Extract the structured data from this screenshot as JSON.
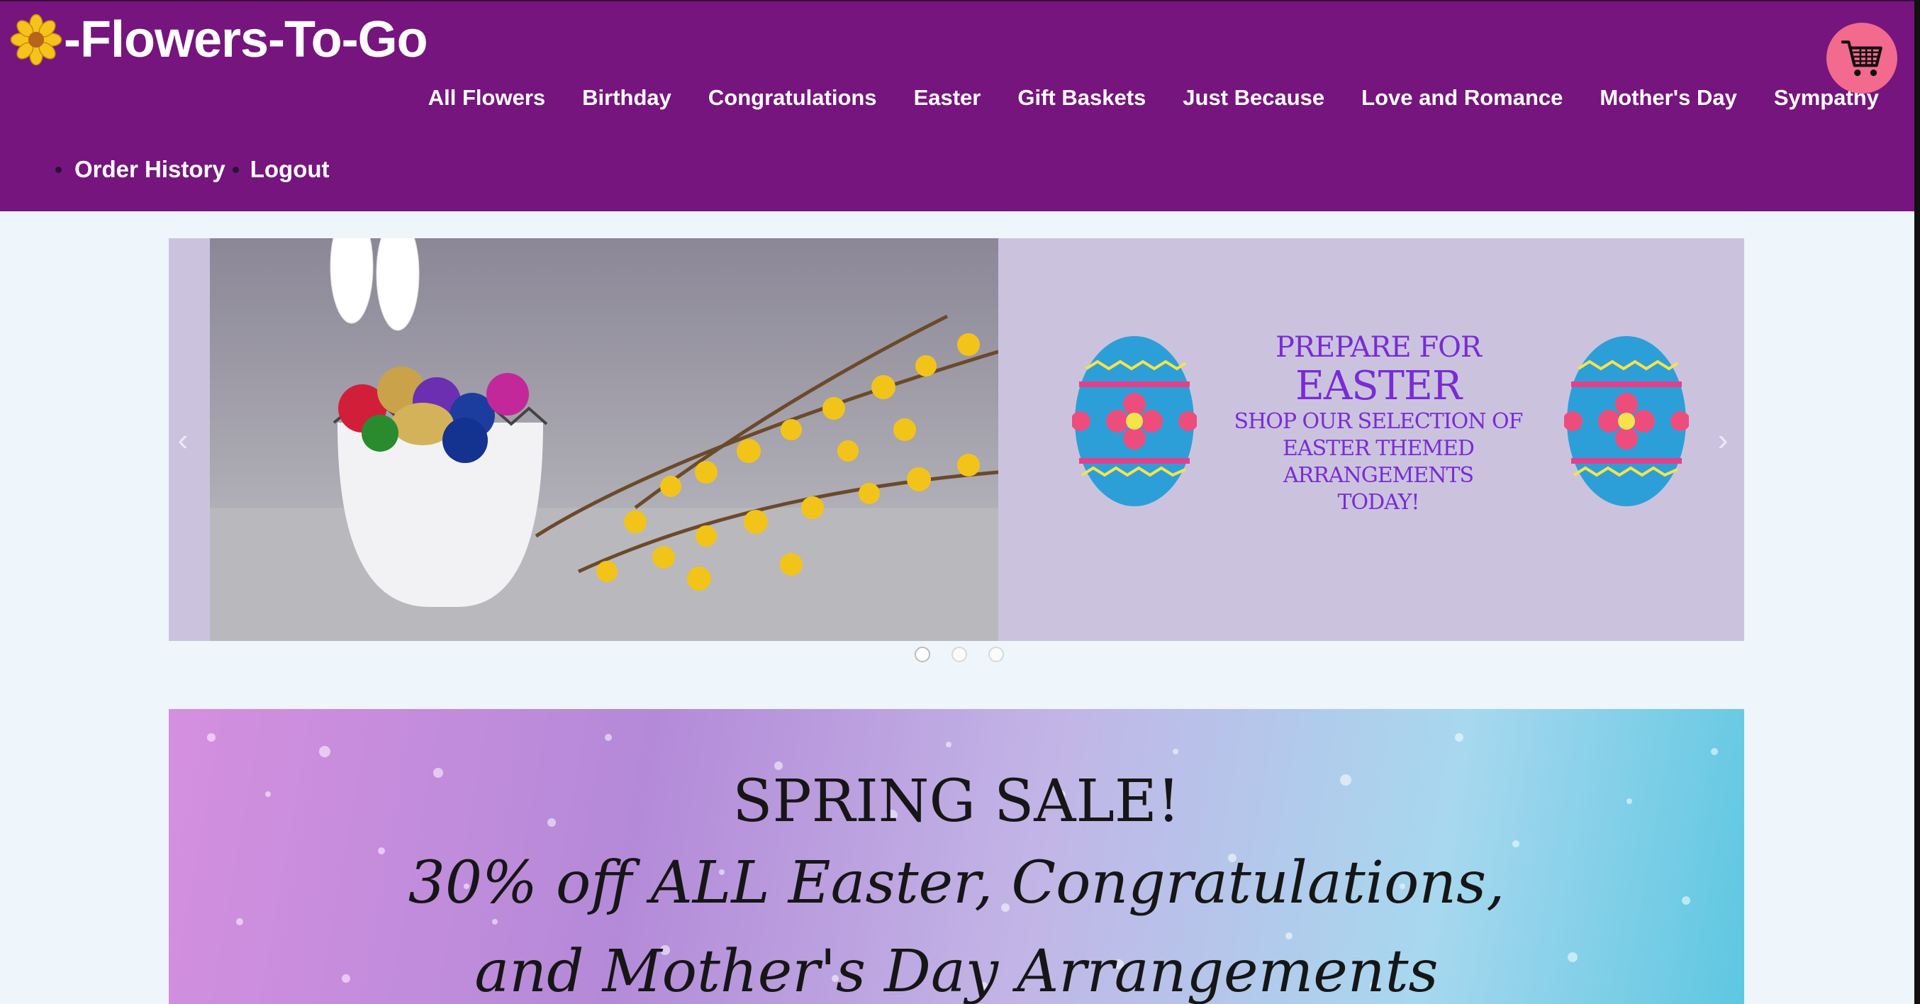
{
  "brand": {
    "name": "-Flowers-To-Go",
    "icon": "flower-icon"
  },
  "nav": {
    "items": [
      "All Flowers",
      "Birthday",
      "Congratulations",
      "Easter",
      "Gift Baskets",
      "Just Because",
      "Love and Romance",
      "Mother's Day",
      "Sympathy"
    ]
  },
  "account": {
    "order_history": "Order History",
    "logout": "Logout"
  },
  "cart": {
    "icon": "cart-icon"
  },
  "carousel": {
    "promo": {
      "line1": "PREPARE FOR",
      "line2": "EASTER",
      "line3": "SHOP OUR SELECTION OF",
      "line4": "EASTER THEMED ARRANGEMENTS",
      "line5": "TODAY!"
    },
    "prev_icon": "chevron-left-icon",
    "next_icon": "chevron-right-icon",
    "slide_count": 3,
    "active_slide": 1
  },
  "sale_banner": {
    "line1": "SPRING SALE!",
    "line2": "30% off ALL Easter, Congratulations,",
    "line3": "and Mother's Day Arrangements"
  },
  "colors": {
    "header_bg": "#76157e",
    "cart_bg": "#f26a8d",
    "promo_text": "#7a2bd6",
    "page_bg": "#eef5fb"
  }
}
